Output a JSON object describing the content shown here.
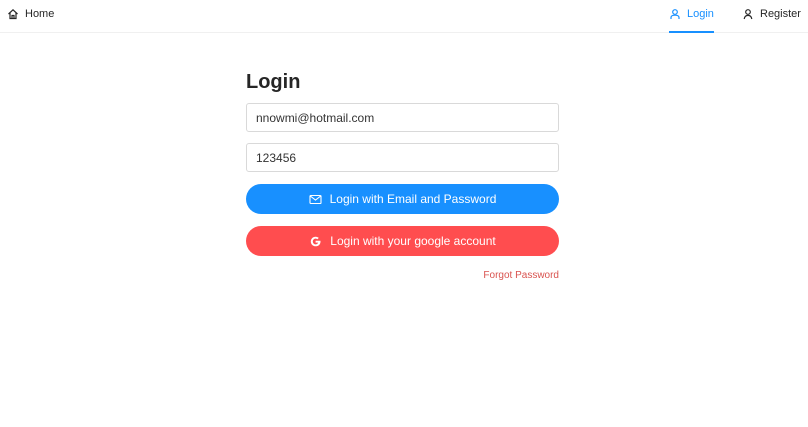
{
  "nav": {
    "home": {
      "label": "Home",
      "icon": "home-icon"
    },
    "login": {
      "label": "Login",
      "icon": "user-icon",
      "active": true
    },
    "register": {
      "label": "Register",
      "icon": "user-icon"
    }
  },
  "form": {
    "title": "Login",
    "email_value": "nnowmi@hotmail.com",
    "password_value": "123456",
    "email_button_label": "Login with Email and Password",
    "email_button_icon": "mail-icon",
    "google_button_label": "Login with your google account",
    "google_button_icon": "google-icon",
    "forgot_label": "Forgot Password"
  },
  "colors": {
    "primary": "#1890ff",
    "danger": "#ff4d4f",
    "link": "#d9534f"
  }
}
